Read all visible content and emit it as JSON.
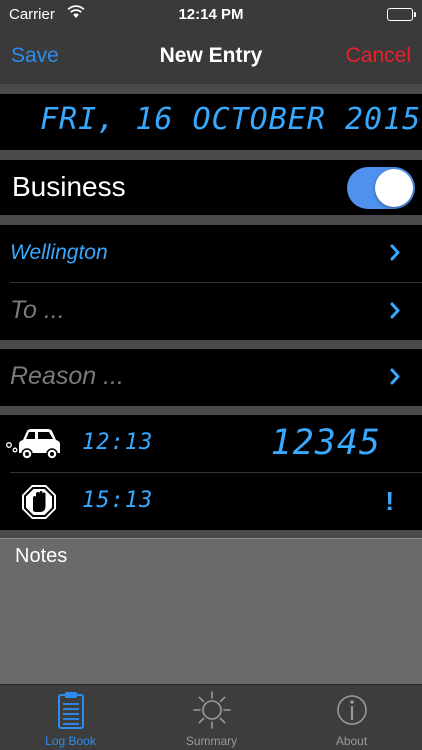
{
  "status_bar": {
    "carrier": "Carrier",
    "time": "12:14 PM"
  },
  "nav": {
    "save_label": "Save",
    "title": "New Entry",
    "cancel_label": "Cancel"
  },
  "entry": {
    "date_display": "FRI, 16 OCTOBER 2015",
    "business_label": "Business",
    "business_enabled": true,
    "from_value": "Wellington",
    "to_placeholder": "To ...",
    "reason_placeholder": "Reason ...",
    "start_time": "12:13",
    "odometer": "12345",
    "stop_time": "15:13",
    "stop_warning": "!",
    "notes_label": "Notes"
  },
  "tabs": [
    {
      "label": "Log Book",
      "icon": "clipboard-icon",
      "active": true
    },
    {
      "label": "Summary",
      "icon": "sun-icon",
      "active": false
    },
    {
      "label": "About",
      "icon": "info-icon",
      "active": false
    }
  ],
  "colors": {
    "accent": "#2d8cf0",
    "lcd": "#38a9ff",
    "cancel": "#e8202a",
    "toggle_on": "#4f91ee"
  }
}
